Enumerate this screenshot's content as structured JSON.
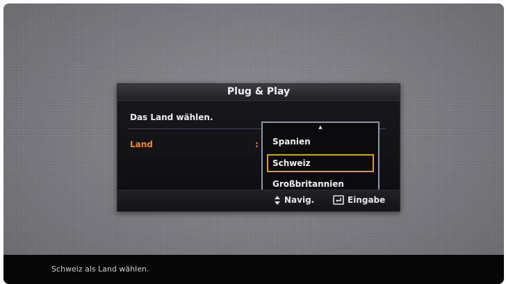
{
  "dialog": {
    "title": "Plug & Play",
    "prompt": "Das Land wählen.",
    "field_label": "Land",
    "field_separator": ":",
    "options": [
      "Spanien",
      "Schweiz",
      "Großbritannien"
    ],
    "selected_option": "Schweiz",
    "scroll_up_icon": "arrow-up-icon",
    "scroll_down_icon": "arrow-down-icon",
    "accent_color": "#d8a22a",
    "label_color": "#f0892a"
  },
  "footer": {
    "nav_icon": "up-down-arrows-icon",
    "nav_label": "Navig.",
    "enter_icon": "enter-icon",
    "enter_label": "Eingabe"
  },
  "status_bar": {
    "text": "Schweiz als Land wählen."
  }
}
